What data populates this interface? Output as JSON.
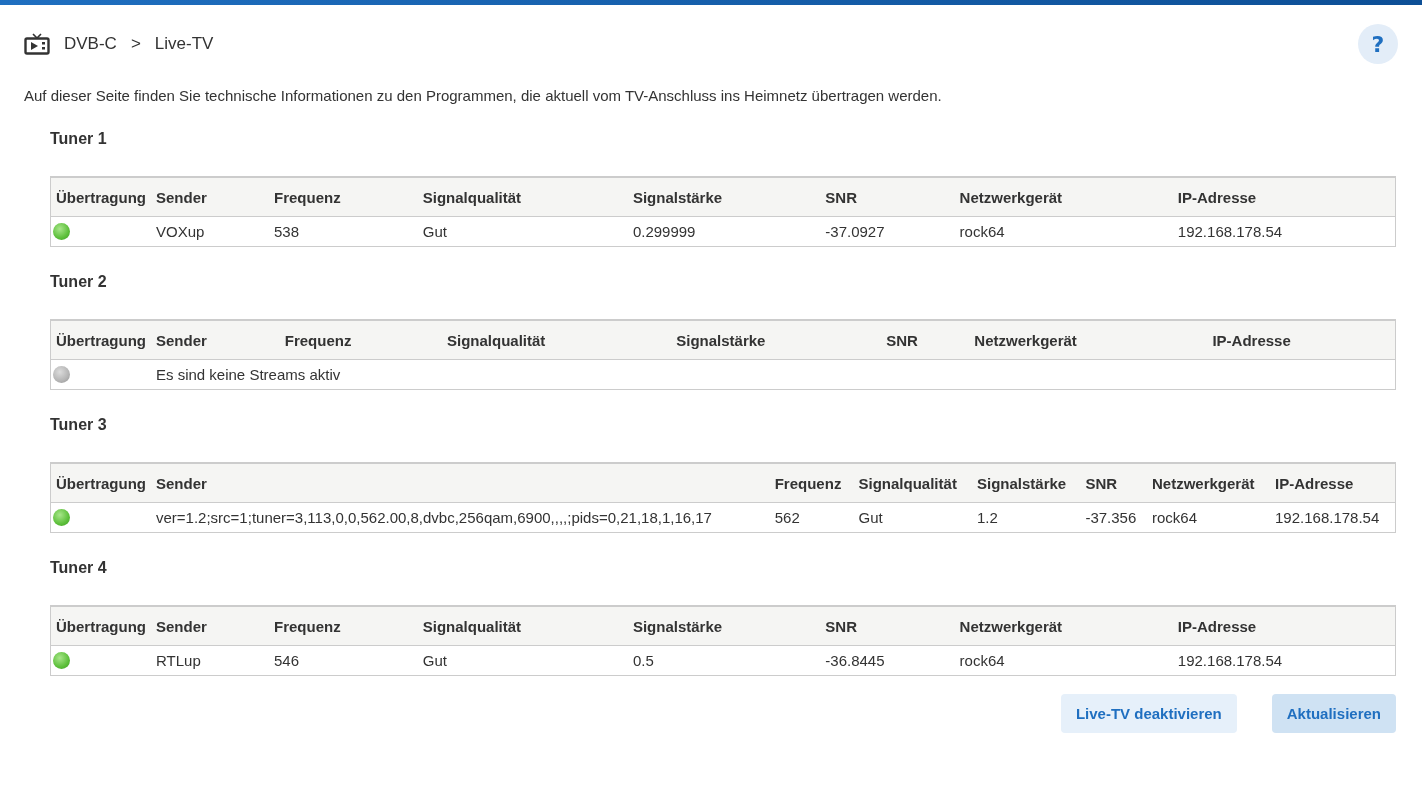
{
  "breadcrumb": {
    "items": [
      "DVB-C",
      "Live-TV"
    ],
    "separator": ">"
  },
  "help": {
    "label": "?"
  },
  "intro": "Auf dieser Seite finden Sie technische Informationen zu den Programmen, die aktuell vom TV-Anschluss ins Heimnetz übertragen werden.",
  "tuners": [
    {
      "title": "Tuner 1",
      "columns": [
        "Übertragung",
        "Sender",
        "Frequenz",
        "Signalqualität",
        "Signalstärke",
        "SNR",
        "Netzwerkgerät",
        "IP-Adresse"
      ],
      "rows": [
        {
          "kind": "stream",
          "active": true,
          "cells": [
            "",
            "VOXup",
            "538",
            "Gut",
            "0.299999",
            "-37.0927",
            "rock64",
            "192.168.178.54"
          ]
        }
      ]
    },
    {
      "title": "Tuner 2",
      "columns": [
        "Übertragung",
        "Sender",
        "Frequenz",
        "Signalqualität",
        "Signalstärke",
        "SNR",
        "Netzwerkgerät",
        "IP-Adresse"
      ],
      "rows": [
        {
          "kind": "empty",
          "active": false,
          "message": "Es sind keine Streams aktiv"
        }
      ]
    },
    {
      "title": "Tuner 3",
      "columns": [
        "Übertragung",
        "Sender",
        "Frequenz",
        "Signalqualität",
        "Signalstärke",
        "SNR",
        "Netzwerkgerät",
        "IP-Adresse"
      ],
      "rows": [
        {
          "kind": "stream",
          "active": true,
          "cells": [
            "",
            "ver=1.2;src=1;tuner=3,113,0,0,562.00,8,dvbc,256qam,6900,,,,;pids=0,21,18,1,16,17",
            "562",
            "Gut",
            "1.2",
            "-37.356",
            "rock64",
            "192.168.178.54"
          ]
        }
      ]
    },
    {
      "title": "Tuner 4",
      "columns": [
        "Übertragung",
        "Sender",
        "Frequenz",
        "Signalqualität",
        "Signalstärke",
        "SNR",
        "Netzwerkgerät",
        "IP-Adresse"
      ],
      "rows": [
        {
          "kind": "stream",
          "active": true,
          "cells": [
            "",
            "RTLup",
            "546",
            "Gut",
            "0.5",
            "-36.8445",
            "rock64",
            "192.168.178.54"
          ]
        }
      ]
    }
  ],
  "buttons": [
    {
      "label": "Live-TV deaktivieren",
      "hovered": false
    },
    {
      "label": "Aktualisieren",
      "hovered": true
    }
  ]
}
